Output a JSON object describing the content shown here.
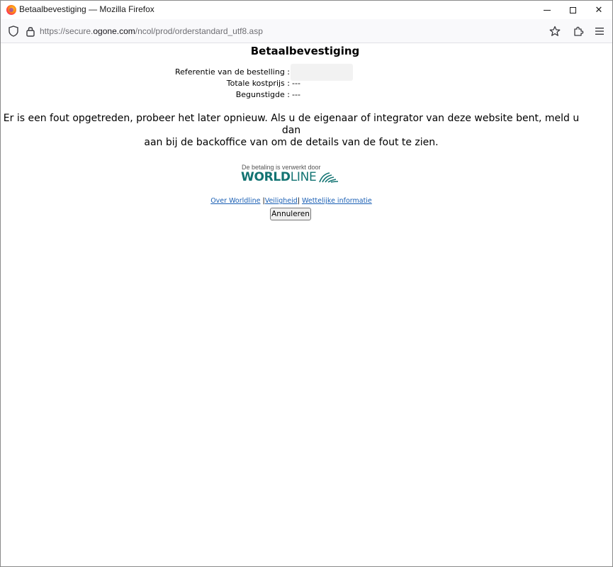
{
  "window": {
    "title": "Betaalbevestiging — Mozilla Firefox",
    "minimize_label": "",
    "maximize_label": "",
    "close_label": "✕"
  },
  "navbar": {
    "url_prefix": "https://secure.",
    "url_host": "ogone.com",
    "url_path": "/ncol/prod/orderstandard_utf8.asp"
  },
  "page": {
    "title": "Betaalbevestiging",
    "details": [
      {
        "label": "Referentie van de bestelling :",
        "value": ""
      },
      {
        "label": "Totale kostprijs :",
        "value": "---"
      },
      {
        "label": "Begunstigde :",
        "value": "---"
      }
    ],
    "error_line1": "Er is een fout opgetreden, probeer het later opnieuw. Als u de eigenaar of integrator van deze website bent, meld u dan",
    "error_line2": "aan bij de backoffice van om de details van de fout te zien.",
    "processed_by": "De betaling is verwerkt door",
    "logo_bold": "WORLD",
    "logo_light": "LINE",
    "links": {
      "about": "Over Worldline",
      "security": "Veiligheid",
      "legal": "Wettelijke informatie",
      "separator": "|"
    },
    "cancel_button": "Annuleren"
  },
  "colors": {
    "brand": "#127372",
    "link": "#1a5fb4",
    "accent_bar": "#2e6b52"
  },
  "icons": [
    "firefox-icon",
    "shield-icon",
    "lock-icon",
    "star-icon",
    "extensions-icon",
    "menu-icon",
    "worldline-waves-icon"
  ]
}
